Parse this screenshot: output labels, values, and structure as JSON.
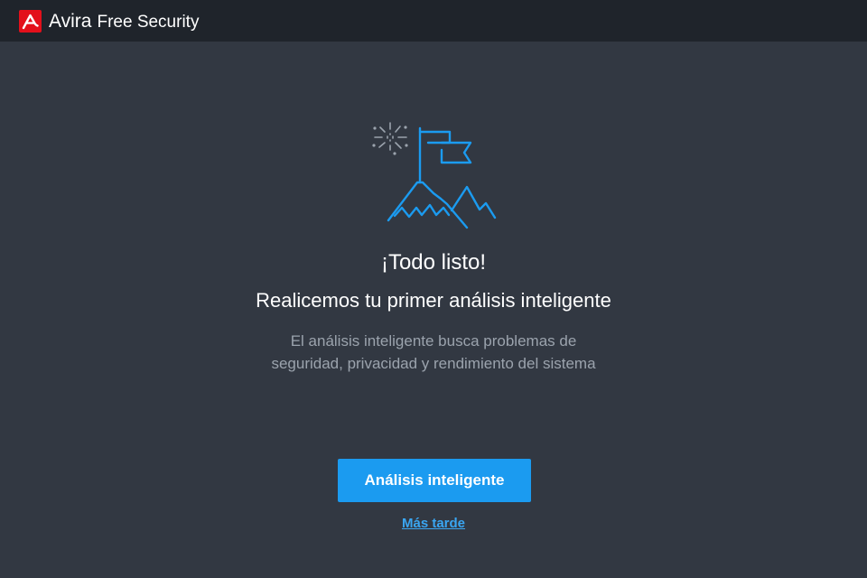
{
  "app": {
    "brand": "Avira",
    "product": "Free Security",
    "logo_icon": "avira-logo-icon",
    "accent_color": "#e3101b"
  },
  "illustration": {
    "icon": "mountain-flag-icon",
    "color": "#1b9bf0"
  },
  "content": {
    "heading": "¡Todo listo!",
    "subheading": "Realicemos tu primer análisis inteligente",
    "description": "El análisis inteligente busca problemas de seguridad, privacidad y rendimiento del sistema"
  },
  "actions": {
    "primary_label": "Análisis inteligente",
    "primary_color": "#1b9bf0",
    "later_label": "Más tarde"
  }
}
